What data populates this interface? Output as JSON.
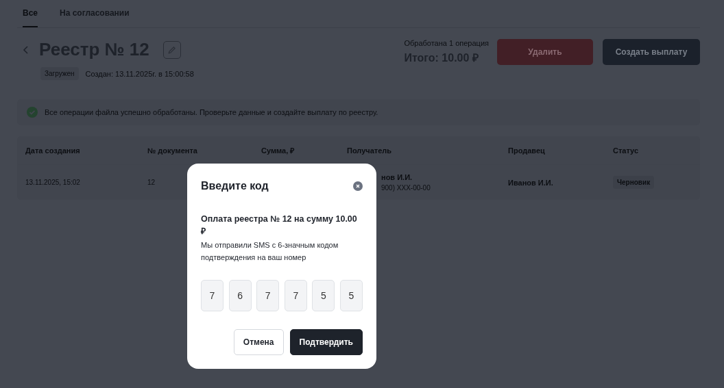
{
  "tabs": [
    {
      "label": "Все",
      "selected": true
    },
    {
      "label": "На согласовании",
      "selected": false
    }
  ],
  "header": {
    "title": "Реестр № 12",
    "status_badge": "Загружен",
    "created": "Создан: 13.11.2025г. в 15:00:58",
    "processed": "Обработана 1 операция",
    "total": "Итого: 10.00 ₽",
    "buttons": [
      {
        "label": "Удалить",
        "kind": "danger"
      },
      {
        "label": "Создать выплату",
        "kind": "primary"
      }
    ]
  },
  "alert": {
    "text": "Все операции файла успешно обработаны. Проверьте данные и создайте выплату по реестру."
  },
  "table": {
    "columns": [
      "Дата создания",
      "№ документа",
      "Сумма, ₽",
      "Получатель",
      "Продавец",
      "Статус"
    ],
    "rows": [
      {
        "date": "13.11.2025, 15:02",
        "document": "12",
        "recipient_name": "нов И.И.",
        "recipient_phone": "900) XXX-00-00",
        "seller": "Иванов И.И.",
        "status": "Черновик"
      }
    ]
  },
  "modal": {
    "title": "Введите код",
    "heading": "Оплата реестра № 12 на сумму 10.00 ₽",
    "text": "Мы отправили SMS с 6-значным кодом подтверждения на ваш номер",
    "code": [
      "7",
      "6",
      "7",
      "7",
      "5",
      "5"
    ],
    "buttons": [
      {
        "label": "Отмена",
        "kind": "secondary"
      },
      {
        "label": "Подтвердить",
        "kind": "primary"
      }
    ]
  }
}
